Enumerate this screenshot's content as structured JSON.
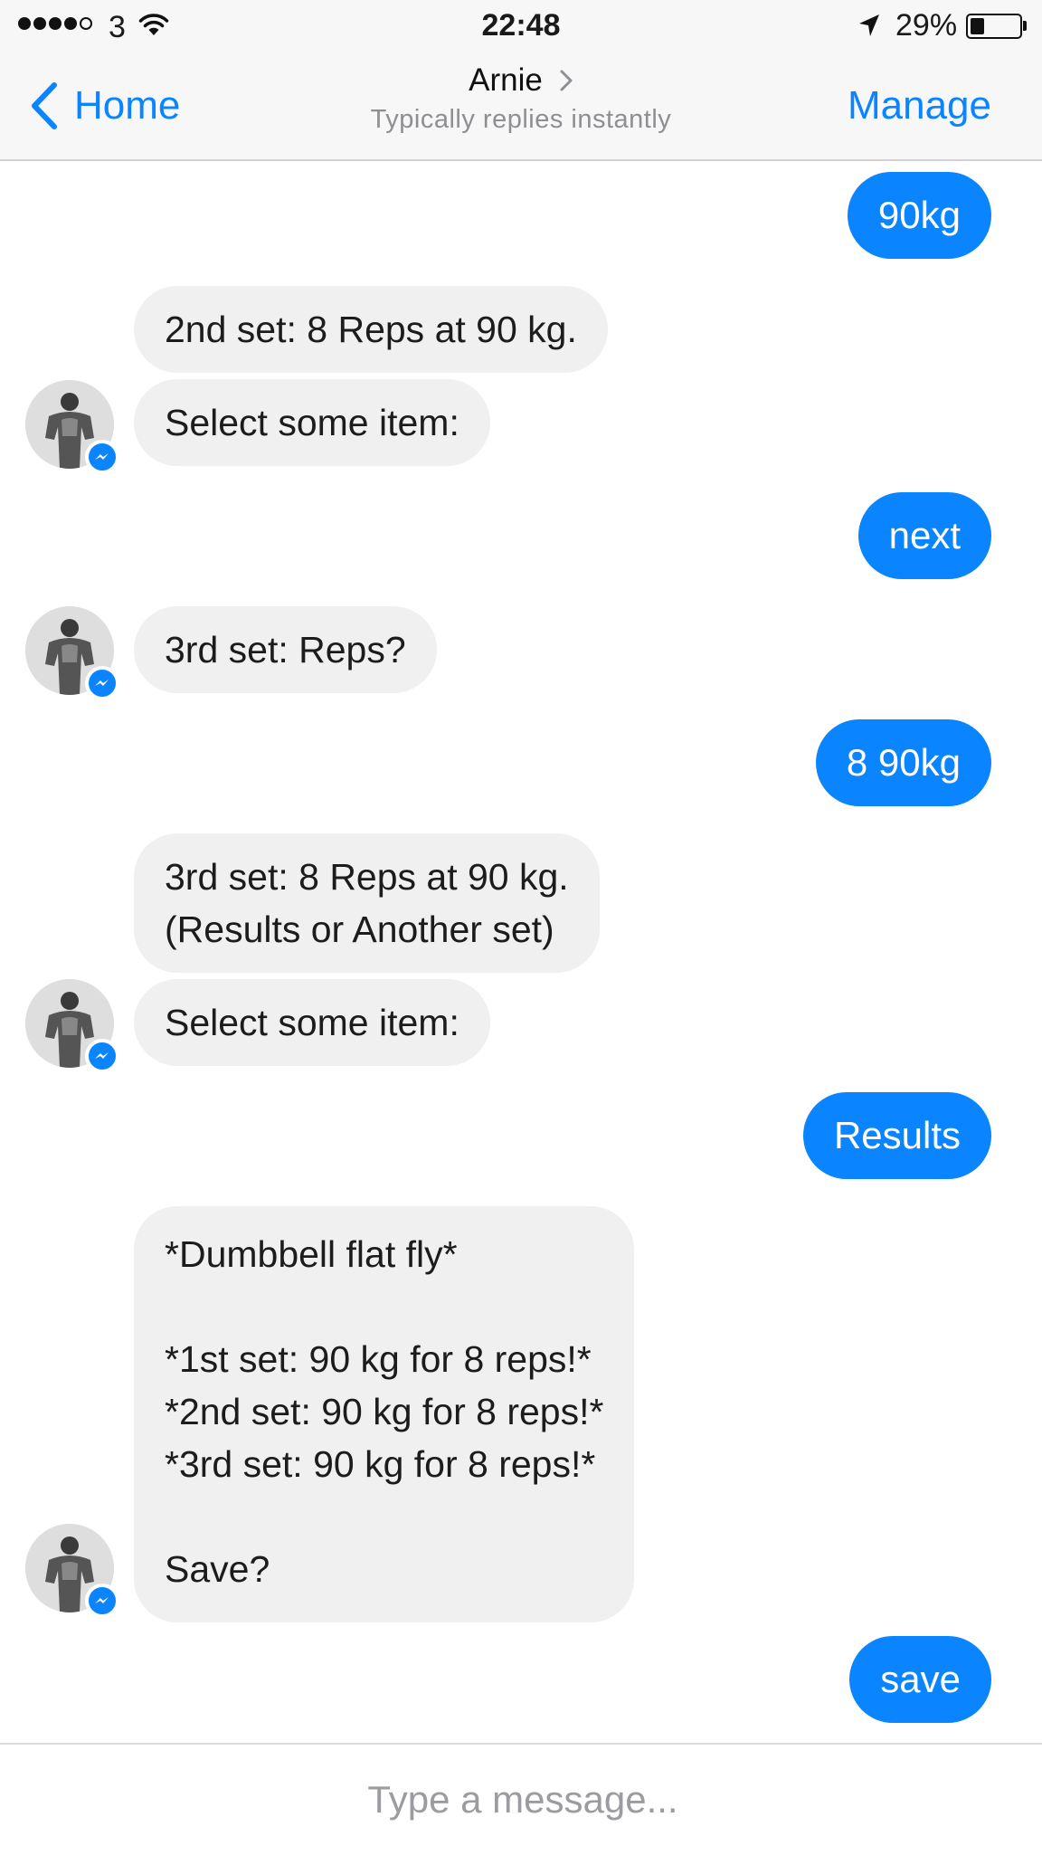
{
  "status_bar": {
    "carrier": "3",
    "time": "22:48",
    "battery_percent": "29%",
    "battery_level": 0.29,
    "signal_bars_filled": 4,
    "signal_bars_total": 5
  },
  "nav": {
    "back_label": "Home",
    "contact_name": "Arnie",
    "contact_subtitle": "Typically replies instantly",
    "manage_label": "Manage"
  },
  "messages": [
    {
      "from": "me",
      "text": "90kg"
    },
    {
      "from": "bot",
      "text": "2nd set: 8 Reps at 90 kg."
    },
    {
      "from": "bot",
      "text": "Select some item:"
    },
    {
      "from": "me",
      "text": "next"
    },
    {
      "from": "bot",
      "text": "3rd set: Reps?"
    },
    {
      "from": "me",
      "text": "8 90kg"
    },
    {
      "from": "bot",
      "text": "3rd set: 8 Reps at 90 kg.\n(Results or Another set)"
    },
    {
      "from": "bot",
      "text": "Select some item:"
    },
    {
      "from": "me",
      "text": "Results"
    },
    {
      "from": "bot",
      "text": "*Dumbbell flat fly*\n\n*1st set: 90 kg for 8 reps!*\n*2nd set: 90 kg for 8 reps!*\n*3rd set: 90 kg for 8 reps!*\n\nSave?"
    },
    {
      "from": "me",
      "text": "save"
    }
  ],
  "composer": {
    "placeholder": "Type a message..."
  },
  "colors": {
    "accent": "#0a84ff",
    "incoming_bubble": "#f0f0f0",
    "bar_background": "#f7f7f8"
  },
  "icons": {
    "back": "chevron-left-icon",
    "contact_details": "chevron-right-icon",
    "wifi": "wifi-icon",
    "location": "location-arrow-icon",
    "battery": "battery-icon",
    "messenger": "messenger-icon"
  }
}
